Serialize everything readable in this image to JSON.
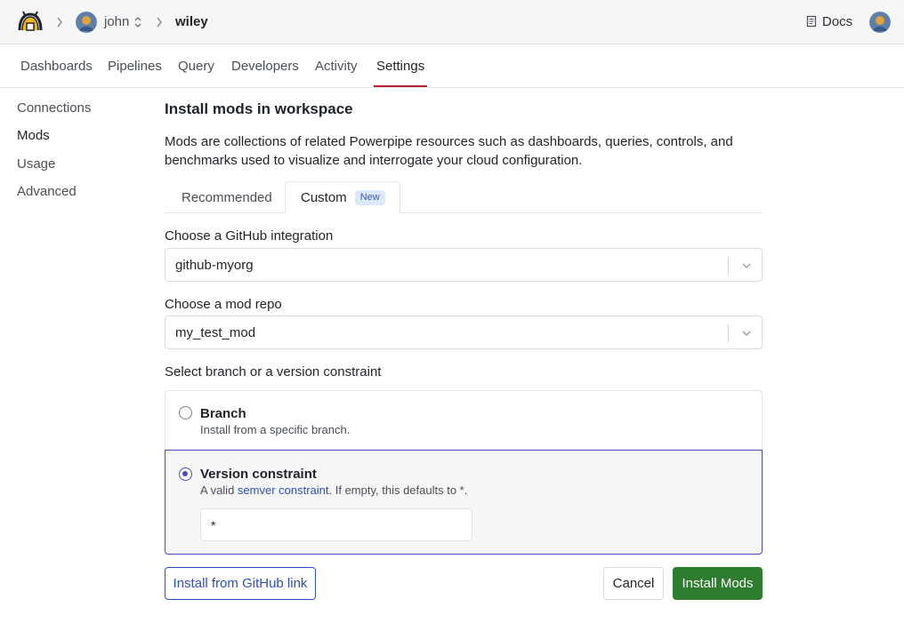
{
  "breadcrumb": {
    "user": "john",
    "workspace": "wiley"
  },
  "header": {
    "docs_label": "Docs"
  },
  "nav": {
    "tabs": [
      "Dashboards",
      "Pipelines",
      "Query",
      "Developers",
      "Activity",
      "Settings"
    ],
    "active": "Settings"
  },
  "sidebar": {
    "items": [
      "Connections",
      "Mods",
      "Usage",
      "Advanced"
    ],
    "active": "Mods"
  },
  "main": {
    "title": "Install mods in workspace",
    "description": "Mods are collections of related Powerpipe resources such as dashboards, queries, controls, and benchmarks used to visualize and interrogate your cloud configuration.",
    "tabs": {
      "recommended": "Recommended",
      "custom": "Custom",
      "custom_badge": "New"
    },
    "integration": {
      "label": "Choose a GitHub integration",
      "value": "github-myorg"
    },
    "repo": {
      "label": "Choose a mod repo",
      "value": "my_test_mod"
    },
    "constraint": {
      "label": "Select branch or a version constraint",
      "branch_title": "Branch",
      "branch_sub": "Install from a specific branch.",
      "version_title": "Version constraint",
      "version_sub_prefix": "A valid ",
      "version_sub_link": "semver constraint",
      "version_sub_suffix": ". If empty, this defaults to *.",
      "version_value": "*",
      "selected": "version"
    },
    "buttons": {
      "github_link": "Install from GitHub link",
      "cancel": "Cancel",
      "install": "Install Mods"
    }
  },
  "colors": {
    "accent_nav": "#b3202e",
    "selected_option": "#4a48c8",
    "install_button": "#2e7d2e",
    "link": "#2d4ec3"
  }
}
